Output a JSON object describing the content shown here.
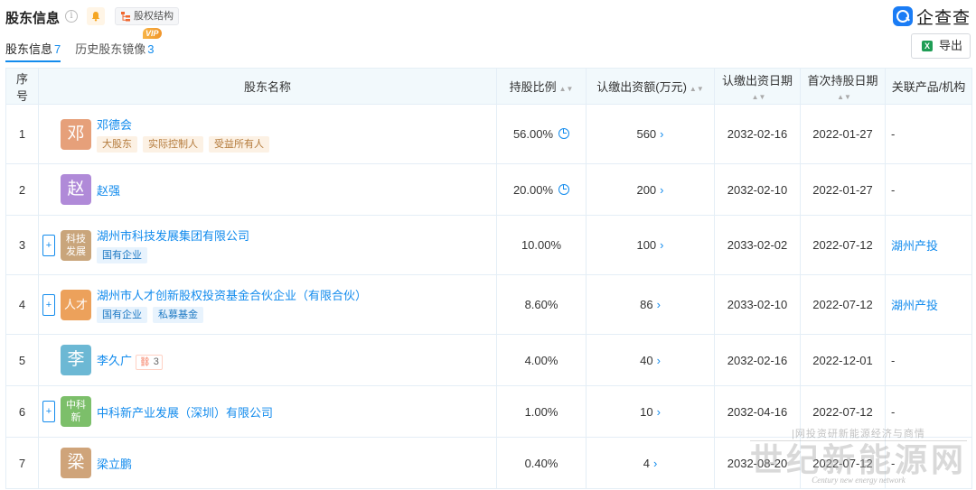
{
  "header": {
    "title": "股东信息",
    "info_glyph": "i",
    "equity_label": "股权结构",
    "logo_text": "企查查"
  },
  "tabs": [
    {
      "label": "股东信息",
      "count": "7"
    },
    {
      "label": "历史股东镜像",
      "count": "3",
      "badge": "VIP"
    }
  ],
  "export_label": "导出",
  "columns": {
    "idx": "序号",
    "name": "股东名称",
    "pct": "持股比例",
    "amount": "认缴出资额(万元)",
    "date": "认缴出资日期",
    "first_date": "首次持股日期",
    "related": "关联产品/机构"
  },
  "rows": [
    {
      "idx": "1",
      "avatar": "邓",
      "avatar_color": "#e6a07a",
      "name": "邓德会",
      "tags": [
        "大股东",
        "实际控制人",
        "受益所有人"
      ],
      "tag_style": "orange",
      "pct": "56.00%",
      "amount": "560",
      "date": "2032-02-16",
      "first": "2022-01-27",
      "related": "-"
    },
    {
      "idx": "2",
      "avatar": "赵",
      "avatar_color": "#b08ad8",
      "name": "赵强",
      "pct": "20.00%",
      "amount": "200",
      "date": "2032-02-10",
      "first": "2022-01-27",
      "related": "-"
    },
    {
      "idx": "3",
      "avatar_lines": [
        "科技",
        "发展"
      ],
      "avatar_color": "#c9a57b",
      "name": "湖州市科技发展集团有限公司",
      "tags": [
        "国有企业"
      ],
      "tag_style": "blue",
      "pct": "10.00%",
      "amount": "100",
      "date": "2033-02-02",
      "first": "2022-07-12",
      "related": "湖州产投"
    },
    {
      "idx": "4",
      "avatar": "人才",
      "avatar_color": "#eca15b",
      "name": "湖州市人才创新股权投资基金合伙企业（有限合伙）",
      "tags": [
        "国有企业",
        "私募基金"
      ],
      "tag_style": "blue",
      "pct": "8.60%",
      "amount": "86",
      "date": "2033-02-10",
      "first": "2022-07-12",
      "related": "湖州产投"
    },
    {
      "idx": "5",
      "avatar": "李",
      "avatar_color": "#6cb8d4",
      "name": "李久广",
      "rel_count": "3",
      "pct": "4.00%",
      "amount": "40",
      "date": "2032-02-16",
      "first": "2022-12-01",
      "related": "-"
    },
    {
      "idx": "6",
      "avatar_lines": [
        "中科",
        "新"
      ],
      "avatar_color": "#7cbf6a",
      "name": "中科新产业发展（深圳）有限公司",
      "pct": "1.00%",
      "amount": "10",
      "date": "2032-04-16",
      "first": "2022-07-12",
      "related": "-"
    },
    {
      "idx": "7",
      "avatar": "梁",
      "avatar_color": "#cfa47a",
      "name": "梁立鹏",
      "pct": "0.40%",
      "amount": "4",
      "date": "2032-08-20",
      "first": "2022-07-12",
      "related": "-"
    }
  ],
  "watermark": {
    "line1": "|网投资研新能源经济与商情",
    "big": "世纪新能源网",
    "sub": "Century new energy network"
  }
}
